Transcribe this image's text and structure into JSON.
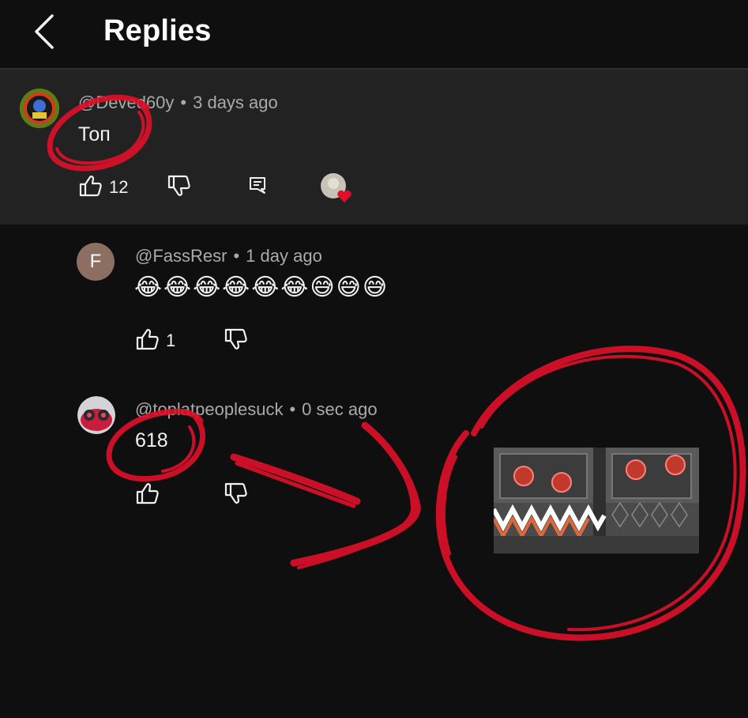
{
  "header": {
    "title": "Replies"
  },
  "parent_comment": {
    "author": "@Deved60y",
    "time": "3 days ago",
    "text": "Топ",
    "likes": "12"
  },
  "replies": [
    {
      "avatar_letter": "F",
      "author": "@FassResr",
      "time": "1 day ago",
      "text": "😂😂😂😂😂😂😅😅😅",
      "likes": "1"
    },
    {
      "author": "@toplatpeoplesuck",
      "time": "0 sec ago",
      "text": "618",
      "likes": ""
    }
  ],
  "colors": {
    "background": "#0f0f0f",
    "parent_background": "#222222",
    "annotation_red": "#e0102a",
    "heart": "#e0102a"
  },
  "icons": [
    "back-chevron-icon",
    "like-icon",
    "dislike-icon",
    "reply-icon",
    "heart-icon"
  ]
}
